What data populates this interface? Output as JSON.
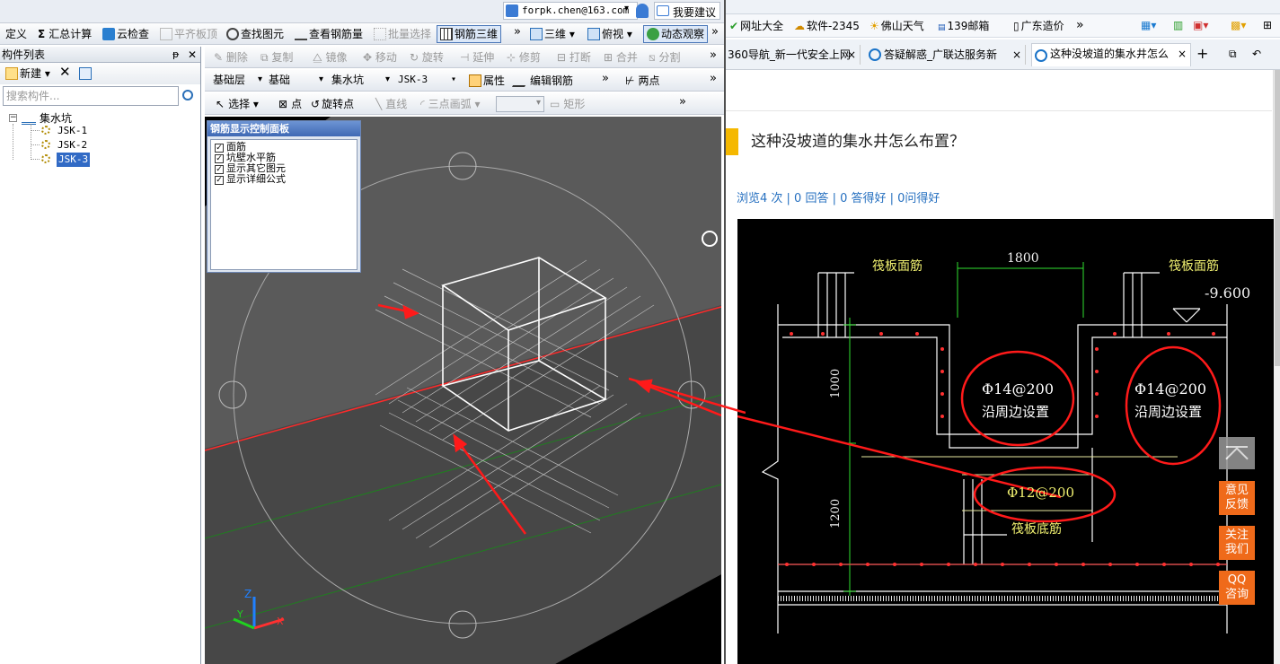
{
  "app": {
    "account": "forpk.chen@163.com",
    "feedback": "我要建议",
    "toolbar1": {
      "define": "定义",
      "sum": "汇总计算",
      "cloud_check": "云检查",
      "level_slab": "平齐板顶",
      "find_element": "查找图元",
      "view_rebar": "查看钢筋量",
      "batch_select": "批量选择",
      "rebar_3d": "钢筋三维",
      "view3d": "三维",
      "top_view": "俯视",
      "dynamic": "动态观察"
    },
    "toolbar2": {
      "delete": "删除",
      "copy": "复制",
      "mirror": "镜像",
      "move": "移动",
      "rotate": "旋转",
      "extend": "延伸",
      "trim": "修剪",
      "break": "打断",
      "merge": "合并",
      "split": "分割"
    },
    "toolbar3": {
      "layer": "基础层",
      "category": "基础",
      "type": "集水坑",
      "component": "JSK-3",
      "properties": "属性",
      "edit_rebar": "编辑钢筋",
      "two_points": "两点"
    },
    "toolbar4": {
      "select": "选择",
      "point": "点",
      "rotate_point": "旋转点",
      "line": "直线",
      "arc3": "三点画弧",
      "rect": "矩形"
    },
    "component_list": {
      "title": "构件列表",
      "new": "新建",
      "search_placeholder": "搜索构件...",
      "root": "集水坑",
      "items": [
        "JSK-1",
        "JSK-2",
        "JSK-3"
      ]
    },
    "rebar_panel": {
      "title": "钢筋显示控制面板",
      "options": [
        "面筋",
        "坑壁水平筋",
        "显示其它图元",
        "显示详细公式"
      ]
    },
    "axes": {
      "z": "Z",
      "y": "Y",
      "x": "X"
    }
  },
  "browser": {
    "bookmarks": [
      "网址大全",
      "软件-2345",
      "佛山天气",
      "139邮箱",
      "广东造价"
    ],
    "tabs": [
      "360导航_新一代安全上网",
      "答疑解惑_广联达服务新",
      "这种没坡道的集水井怎么"
    ],
    "question": {
      "title": "这种没坡道的集水井怎么布置？",
      "stats": "浏览4 次 | 0 回答 | 0 答得好 | 0问得好"
    },
    "drawing": {
      "top_left_label": "筏板面筋",
      "top_right_label": "筏板面筋",
      "width": "1800",
      "elevation": "-9.600",
      "dim1": "1000",
      "dim2": "1200",
      "note1a": "Φ14@200",
      "note1b": "沿周边设置",
      "note2a": "Φ14@200",
      "note2b": "沿周边设置",
      "note3": "Φ12@200",
      "bottom_label": "筏板底筋"
    },
    "side": {
      "feedback": "意见反馈",
      "follow": "关注我们",
      "qq": "QQ咨询"
    }
  }
}
